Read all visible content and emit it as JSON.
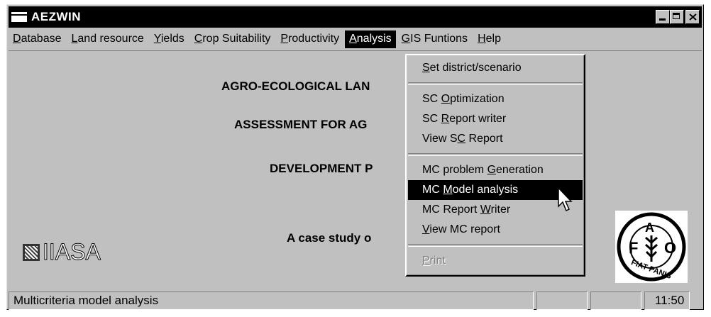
{
  "window": {
    "title": "AEZWIN"
  },
  "menubar": {
    "items": [
      {
        "pre": "",
        "u": "D",
        "post": "atabase"
      },
      {
        "pre": "",
        "u": "L",
        "post": "and resource"
      },
      {
        "pre": "",
        "u": "Y",
        "post": "ields"
      },
      {
        "pre": "",
        "u": "C",
        "post": "rop Suitability"
      },
      {
        "pre": "",
        "u": "P",
        "post": "roductivity"
      },
      {
        "pre": "",
        "u": "A",
        "post": "nalysis"
      },
      {
        "pre": "",
        "u": "G",
        "post": "IS Funtions"
      },
      {
        "pre": "",
        "u": "H",
        "post": "elp"
      }
    ]
  },
  "client": {
    "line1": "AGRO-ECOLOGICAL LAN",
    "line2": "ASSESSMENT FOR AG",
    "line3": "DEVELOPMENT P",
    "line4": "A case study o",
    "logo_left": "IIASA",
    "logo_right": "FIAT PANIS"
  },
  "analysis_menu": {
    "items": [
      {
        "pre": "",
        "u": "S",
        "post": "et district/scenario"
      },
      {
        "pre": "SC ",
        "u": "O",
        "post": "ptimization"
      },
      {
        "pre": "SC ",
        "u": "R",
        "post": "eport  writer"
      },
      {
        "pre": "View S",
        "u": "C",
        "post": " Report"
      },
      {
        "pre": "MC problem ",
        "u": "G",
        "post": "eneration"
      },
      {
        "pre": "MC ",
        "u": "M",
        "post": "odel analysis"
      },
      {
        "pre": "MC Report  ",
        "u": "W",
        "post": "riter"
      },
      {
        "pre": " ",
        "u": "V",
        "post": "iew MC report"
      },
      {
        "pre": "",
        "u": "P",
        "post": "rint"
      }
    ]
  },
  "statusbar": {
    "message": "Multicriteria model analysis",
    "time": "11:50"
  }
}
